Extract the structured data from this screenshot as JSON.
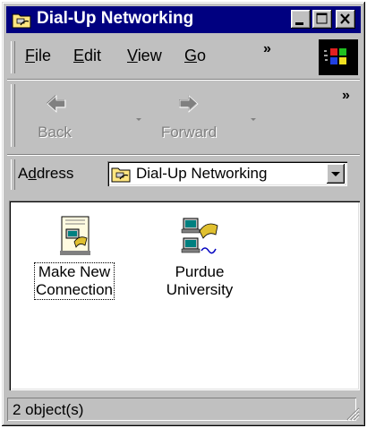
{
  "window": {
    "title": "Dial-Up Networking",
    "controls": [
      "minimize",
      "maximize",
      "close"
    ]
  },
  "menubar": {
    "items": [
      {
        "label": "File",
        "accel": "F",
        "rest": "ile"
      },
      {
        "label": "Edit",
        "accel": "E",
        "rest": "dit"
      },
      {
        "label": "View",
        "accel": "V",
        "rest": "iew"
      },
      {
        "label": "Go",
        "accel": "G",
        "rest": "o"
      }
    ],
    "overflow": "»"
  },
  "toolbar": {
    "back": {
      "label": "Back",
      "icon": "back-arrow-icon",
      "enabled": false
    },
    "forward": {
      "label": "Forward",
      "icon": "forward-arrow-icon",
      "enabled": false
    },
    "overflow": "»"
  },
  "address": {
    "label_pre": "A",
    "label_accel": "d",
    "label_post": "dress",
    "value": "Dial-Up Networking"
  },
  "content": {
    "items": [
      {
        "line1": "Make New",
        "line2": "Connection",
        "icon": "make-new-connection-icon",
        "focused": true
      },
      {
        "line1": "Purdue",
        "line2": "University",
        "icon": "dial-up-connection-icon",
        "focused": false
      }
    ]
  },
  "status": {
    "text": "2 object(s)"
  },
  "colors": {
    "titlebar": "#000080",
    "face": "#c0c0c0",
    "window_bg": "#ffffff"
  }
}
